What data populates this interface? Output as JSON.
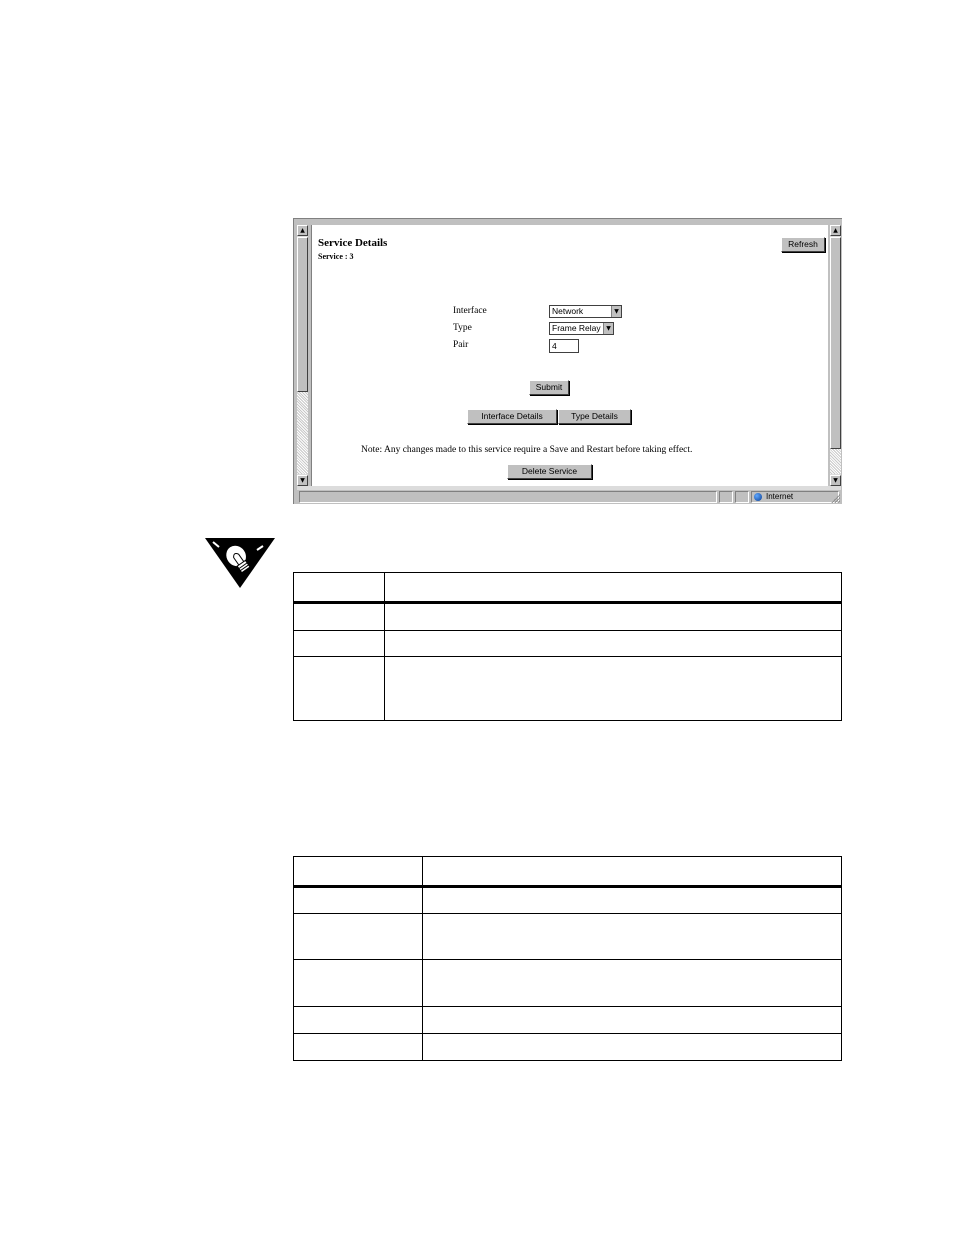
{
  "browser": {
    "page_title": "Service Details",
    "page_subtitle": "Service : 3",
    "refresh_label": "Refresh",
    "form": {
      "interface_label": "Interface",
      "interface_value": "Network",
      "type_label": "Type",
      "type_value": "Frame Relay",
      "pair_label": "Pair",
      "pair_value": "4"
    },
    "submit_label": "Submit",
    "interface_details_label": "Interface Details",
    "type_details_label": "Type Details",
    "note": "Note:  Any changes made to this service require a Save and Restart before taking effect.",
    "delete_label": "Delete Service",
    "status_zone": "Internet"
  },
  "tip_icon": "lightbulb-tip-icon"
}
